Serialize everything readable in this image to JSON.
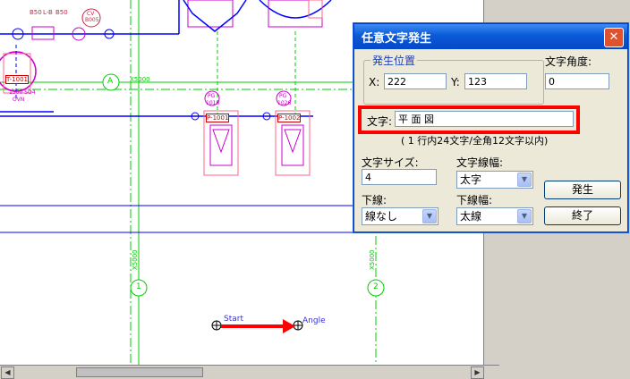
{
  "drawing": {
    "tags_top": [
      "B50",
      "L-B",
      "B50"
    ],
    "cv_label": "CV",
    "cv_num": "B005",
    "tank_label": "T-1001",
    "tank_text1": "1500 SO4",
    "tank_text2": "OVN",
    "axis_a": "A",
    "axis_a_dim": "X5000",
    "pump1_tag": "PG",
    "pump1_num": "1016",
    "pump1_label": "P-1001",
    "pump2_tag": "PG",
    "pump2_num": "1026",
    "pump2_label": "P-1002",
    "axis1": "1",
    "axis2": "2",
    "dim_left": "X5000",
    "dim_right": "X5000",
    "start_text": "Start",
    "angle_text": "Angle",
    "colors": {
      "green": "#00cc00",
      "blue": "#0000ff",
      "magenta": "#cc00cc",
      "red": "#ff0000"
    }
  },
  "dialog": {
    "title": "任意文字発生",
    "close_icon": "close-icon",
    "position_group": "発生位置",
    "x_label": "X:",
    "x_value": "222",
    "y_label": "Y:",
    "y_value": "123",
    "angle_label": "文字角度:",
    "angle_value": "0",
    "text_label": "文字:",
    "text_value": "平 面 図",
    "limit_note": "( 1 行内24文字/全角12文字以内)",
    "size_label": "文字サイズ:",
    "size_value": "4",
    "linewidth_label": "文字線幅:",
    "linewidth_value": "太字",
    "underline_label": "下線:",
    "underline_value": "線なし",
    "underline_width_label": "下線幅:",
    "underline_width_value": "太線",
    "generate_button": "発生",
    "end_button": "終了"
  }
}
